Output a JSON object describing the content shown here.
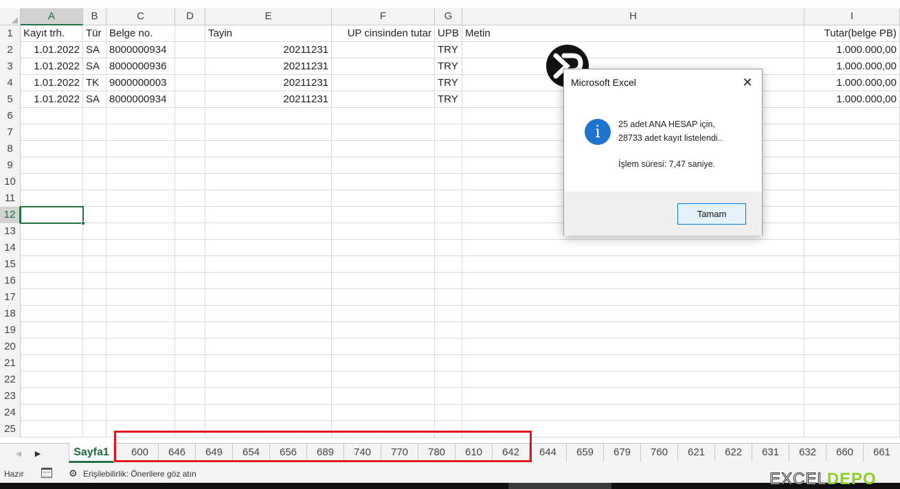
{
  "columns": [
    "A",
    "B",
    "C",
    "D",
    "E",
    "F",
    "G",
    "H",
    "I"
  ],
  "row_numbers": [
    "1",
    "2",
    "3",
    "4",
    "5",
    "6",
    "7",
    "8",
    "9",
    "10",
    "11",
    "12",
    "13",
    "14",
    "15",
    "16",
    "17",
    "18",
    "19",
    "20",
    "21",
    "22",
    "23",
    "24",
    "25"
  ],
  "table": {
    "headers": [
      "Kayıt trh.",
      "Tür",
      "Belge no.",
      "",
      "Tayin",
      "UP cinsinden tutar",
      "UPB",
      "Metin",
      "Tutar(belge PB)"
    ],
    "rows": [
      [
        "1.01.2022",
        "SA",
        "8000000934",
        "",
        "20211231",
        "",
        "TRY",
        "",
        "1.000.000,00"
      ],
      [
        "1.01.2022",
        "SA",
        "8000000936",
        "",
        "20211231",
        "",
        "TRY",
        "",
        "1.000.000,00"
      ],
      [
        "1.01.2022",
        "TK",
        "9000000003",
        "",
        "20211231",
        "",
        "TRY",
        "",
        "1.000.000,00"
      ],
      [
        "1.01.2022",
        "SA",
        "8000000934",
        "",
        "20211231",
        "",
        "TRY",
        "",
        "1.000.000,00"
      ]
    ]
  },
  "selected_cell": {
    "column": "A",
    "row": "12"
  },
  "dialog": {
    "title": "Microsoft Excel",
    "close_glyph": "✕",
    "info_glyph": "i",
    "message_line1": "25 adet ANA HESAP için,",
    "message_line2": "28733 adet kayıt listelendi..",
    "message_line3": "İşlem süresi: 7,47 saniye.",
    "ok_label": "Tamam"
  },
  "sheets": {
    "active": "Sayfa1",
    "highlighted": [
      "600",
      "646",
      "649",
      "654",
      "656",
      "689",
      "740",
      "770",
      "780",
      "610",
      "642"
    ],
    "others": [
      "644",
      "659",
      "679",
      "760",
      "621",
      "622",
      "631",
      "632",
      "660",
      "661"
    ]
  },
  "status": {
    "ready": "Hazır",
    "accessibility": "Erişilebilirlik: Önerilere göz atın"
  },
  "watermark": {
    "excel": "EXCEL",
    "depo": "DEPO"
  },
  "colors": {
    "excel_green": "#217346",
    "highlight_red": "#e0141e",
    "info_blue": "#1e73cf",
    "depo_green": "#8fcf2a"
  },
  "icons": {
    "dialog": "info-icon",
    "logo": "excel-depo-xp-logo",
    "status_mode": "calendar-icon",
    "accessibility": "accessibility-icon"
  }
}
